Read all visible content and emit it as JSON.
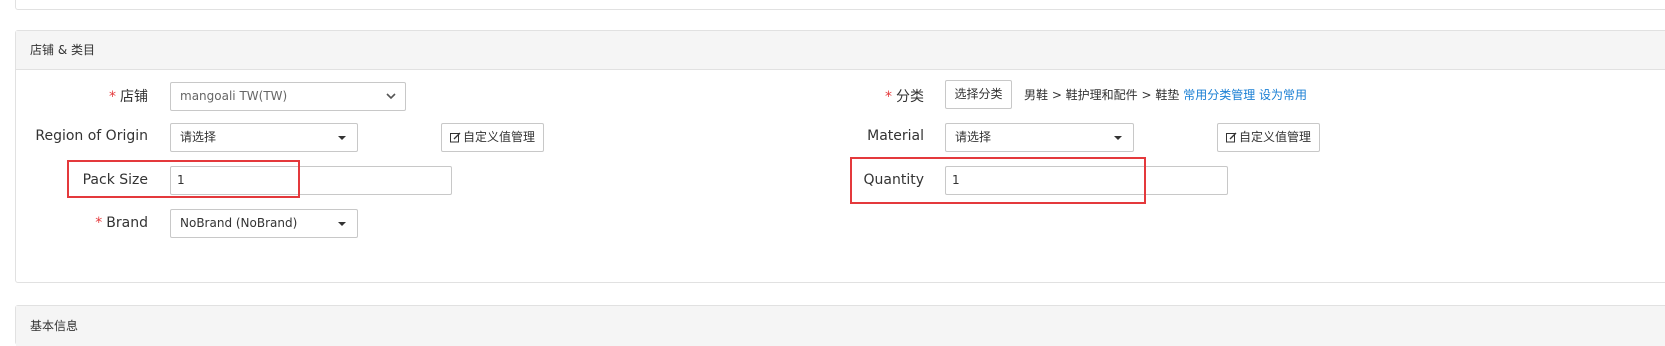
{
  "sections": {
    "store_category": {
      "title": "店铺 & 类目"
    },
    "basic_info": {
      "title": "基本信息"
    }
  },
  "form": {
    "store": {
      "label": "店铺",
      "value": "mangoali TW(TW)"
    },
    "category": {
      "label": "分类",
      "button": "选择分类",
      "path": "男鞋 > 鞋护理和配件 > 鞋垫",
      "manage_link": "常用分类管理",
      "set_common_link": "设为常用"
    },
    "region_of_origin": {
      "label": "Region of Origin",
      "value": "请选择",
      "custom_button": "自定义值管理"
    },
    "material": {
      "label": "Material",
      "value": "请选择",
      "custom_button": "自定义值管理"
    },
    "pack_size": {
      "label": "Pack Size",
      "value": "1"
    },
    "quantity": {
      "label": "Quantity",
      "value": "1"
    },
    "brand": {
      "label": "Brand",
      "value": "NoBrand (NoBrand)"
    },
    "required_mark": "*"
  },
  "colors": {
    "required": "#e4393c",
    "link": "#1a7fd4",
    "highlight": "#e4393c",
    "border": "#c8c8c8"
  }
}
